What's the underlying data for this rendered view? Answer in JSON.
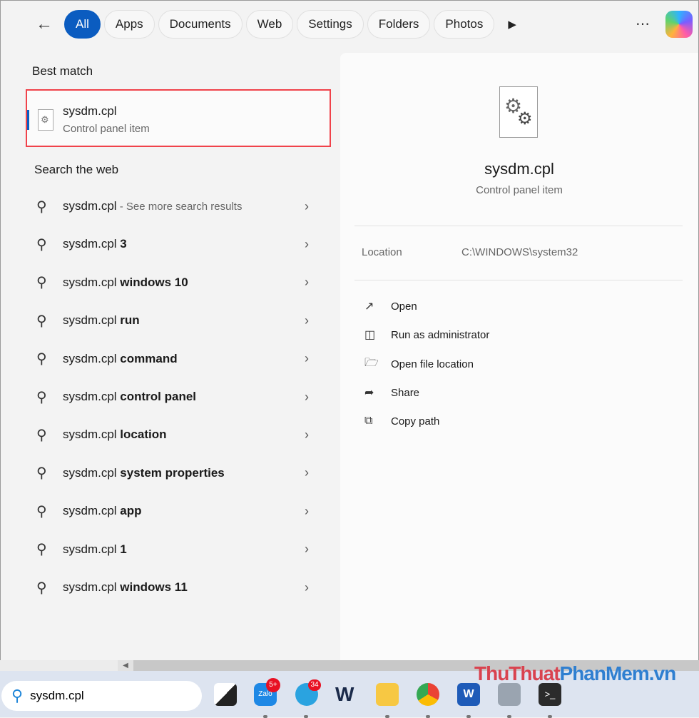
{
  "filters": {
    "tabs": [
      "All",
      "Apps",
      "Documents",
      "Web",
      "Settings",
      "Folders",
      "Photos"
    ],
    "active": "All"
  },
  "best_match": {
    "heading": "Best match",
    "title": "sysdm.cpl",
    "subtitle": "Control panel item"
  },
  "web": {
    "heading": "Search the web",
    "items": [
      {
        "prefix": "sysdm.cpl",
        "bold": "",
        "sub": " - See more search results"
      },
      {
        "prefix": "sysdm.cpl ",
        "bold": "3",
        "sub": ""
      },
      {
        "prefix": "sysdm.cpl ",
        "bold": "windows 10",
        "sub": ""
      },
      {
        "prefix": "sysdm.cpl ",
        "bold": "run",
        "sub": ""
      },
      {
        "prefix": "sysdm.cpl ",
        "bold": "command",
        "sub": ""
      },
      {
        "prefix": "sysdm.cpl ",
        "bold": "control panel",
        "sub": ""
      },
      {
        "prefix": "sysdm.cpl ",
        "bold": "location",
        "sub": ""
      },
      {
        "prefix": "sysdm.cpl ",
        "bold": "system properties",
        "sub": ""
      },
      {
        "prefix": "sysdm.cpl ",
        "bold": "app",
        "sub": ""
      },
      {
        "prefix": "sysdm.cpl ",
        "bold": "1",
        "sub": ""
      },
      {
        "prefix": "sysdm.cpl ",
        "bold": "windows 11",
        "sub": ""
      }
    ]
  },
  "detail": {
    "title": "sysdm.cpl",
    "subtitle": "Control panel item",
    "location_label": "Location",
    "location_value": "C:\\WINDOWS\\system32",
    "actions": [
      {
        "label": "Open",
        "icon": "open-external-icon"
      },
      {
        "label": "Run as administrator",
        "icon": "shield-icon"
      },
      {
        "label": "Open file location",
        "icon": "folder-icon"
      },
      {
        "label": "Share",
        "icon": "share-icon"
      },
      {
        "label": "Copy path",
        "icon": "copy-icon"
      }
    ]
  },
  "taskbar": {
    "search_value": "sysdm.cpl",
    "zalo_badge": "5+",
    "telegram_badge": "34",
    "zalo_label": "Zalo",
    "word_label": "W"
  },
  "watermark": {
    "part1": "ThuThuat",
    "part2": "PhanMem",
    "part3": ".vn"
  },
  "colors": {
    "accent": "#0b5cc0",
    "highlight": "#f0424a"
  }
}
